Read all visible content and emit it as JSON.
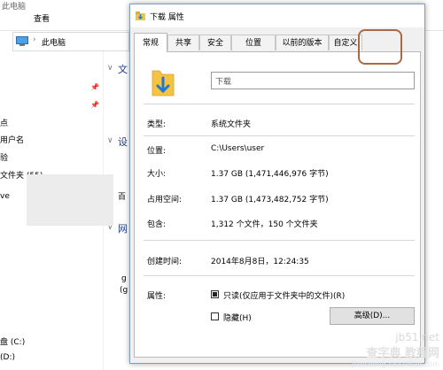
{
  "explorer": {
    "title_fragment": "此电脑",
    "menu_view": "查看",
    "address_text": "此电脑",
    "section_files": "文",
    "section_devices": "设",
    "section_network": "网",
    "left_items": [
      "点",
      "用户名",
      "验",
      "文件夹 (55)",
      "ve"
    ],
    "drives": [
      "盘 (C:)",
      "(D:)"
    ],
    "right_fragments": [
      "百",
      "g",
      "(g"
    ]
  },
  "dialog": {
    "title": "下载 属性",
    "tabs": [
      "常规",
      "共享",
      "安全",
      "位置",
      "以前的版本",
      "自定义"
    ],
    "active_tab": "常规",
    "name_value": "下载",
    "rows": [
      {
        "label": "类型:",
        "value": "系统文件夹"
      },
      {
        "label": "位置:",
        "value": "C:\\Users\\user"
      },
      {
        "label": "大小:",
        "value": "1.37 GB (1,471,446,976 字节)"
      },
      {
        "label": "占用空间:",
        "value": "1.37 GB (1,473,482,752 字节)"
      },
      {
        "label": "包含:",
        "value": "1,312 个文件，150 个文件夹"
      },
      {
        "label": "创建时间:",
        "value": "2014年8月8日，12:24:35"
      }
    ],
    "attributes_label": "属性:",
    "readonly_label": "只读(仅应用于文件夹中的文件)(R)",
    "readonly_checked": true,
    "hidden_label": "隐藏(H)",
    "hidden_checked": false,
    "advanced_button": "高级(D)..."
  },
  "watermark": {
    "line1": "jb51.net",
    "line2": "查字典 教程网",
    "line3": "jiaocheng.chazidian.com"
  },
  "colors": {
    "accent_highlight": "#a86a45",
    "folder_yellow": "#f4c343",
    "arrow_blue": "#1f7ad6"
  }
}
